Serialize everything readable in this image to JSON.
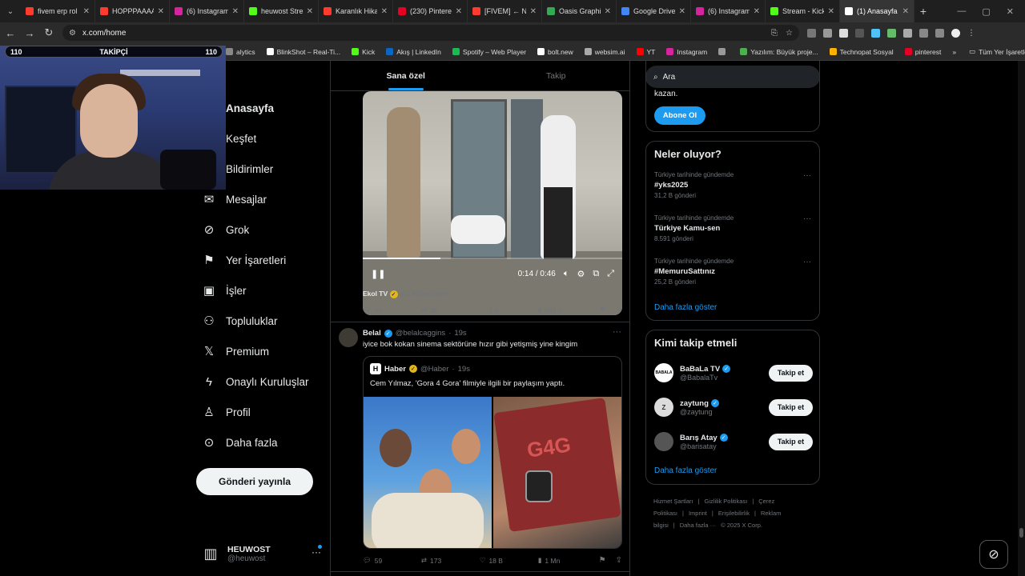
{
  "browser": {
    "tabs": [
      {
        "title": "fivem erp rol",
        "color": "#ff3b30"
      },
      {
        "title": "HOPPPAAAA",
        "color": "#ff3b30"
      },
      {
        "title": "(6) Instagram",
        "color": "#d6249f"
      },
      {
        "title": "heuwost Stream",
        "color": "#53fc18"
      },
      {
        "title": "Karanlık Hikay",
        "color": "#ff3b30"
      },
      {
        "title": "(230) Pinterest",
        "color": "#e60023"
      },
      {
        "title": "[FIVEM] ← NO",
        "color": "#ff3b30"
      },
      {
        "title": "Oasis Graphic",
        "color": "#34a853"
      },
      {
        "title": "Google Drive",
        "color": "#4285f4"
      },
      {
        "title": "(6) Instagram",
        "color": "#d6249f"
      },
      {
        "title": "Stream - Kick",
        "color": "#53fc18"
      },
      {
        "title": "(1) Anasayfa /",
        "color": "#ffffff"
      }
    ],
    "url": "x.com/home",
    "bookmarks": [
      {
        "label": "alytics",
        "color": "#888888"
      },
      {
        "label": "BlinkShot – Real-Ti...",
        "color": "#ffffff"
      },
      {
        "label": "Kick",
        "color": "#53fc18"
      },
      {
        "label": "Akış | LinkedIn",
        "color": "#0a66c2"
      },
      {
        "label": "Spotify – Web Player",
        "color": "#1db954"
      },
      {
        "label": "bolt.new",
        "color": "#ffffff"
      },
      {
        "label": "websim.ai",
        "color": "#aaaaaa"
      },
      {
        "label": "YT",
        "color": "#ff0000"
      },
      {
        "label": "Instagram",
        "color": "#d6249f"
      },
      {
        "label": "",
        "color": "#999999"
      },
      {
        "label": "Yazılım: Büyük proje...",
        "color": "#4caf50"
      },
      {
        "label": "Technopat Sosyal",
        "color": "#ffb300"
      },
      {
        "label": "pinterest",
        "color": "#e60023"
      }
    ],
    "bookmarks_overflow": "»",
    "all_bookmarks": "Tüm Yer İşaretleri"
  },
  "overlay": {
    "follower_left": "110",
    "follower_label": "TAKİPÇİ",
    "follower_right": "110"
  },
  "nav": {
    "items": [
      {
        "label": "Anasayfa",
        "icon": "home-icon"
      },
      {
        "label": "Keşfet",
        "icon": "search-icon"
      },
      {
        "label": "Bildirimler",
        "icon": "bell-icon"
      },
      {
        "label": "Mesajlar",
        "icon": "mail-icon"
      },
      {
        "label": "Grok",
        "icon": "grok-icon"
      },
      {
        "label": "Yer İşaretleri",
        "icon": "bookmark-icon"
      },
      {
        "label": "İşler",
        "icon": "briefcase-icon"
      },
      {
        "label": "Topluluklar",
        "icon": "people-icon"
      },
      {
        "label": "Premium",
        "icon": "x-logo-icon"
      },
      {
        "label": "Onaylı Kuruluşlar",
        "icon": "lightning-icon"
      },
      {
        "label": "Profil",
        "icon": "person-icon"
      },
      {
        "label": "Daha fazla",
        "icon": "more-circle-icon"
      }
    ],
    "post_button": "Gönderi yayınla",
    "account": {
      "name": "HEUWOST",
      "handle": "@heuwost"
    }
  },
  "feed": {
    "tabs": [
      "Sana özel",
      "Takip"
    ],
    "post1": {
      "video_time": "0:14 / 0:46",
      "video_progress": 0.3,
      "source_name": "Ekol TV",
      "source_suffix": "adlı kullanıcıdan",
      "replies": "46",
      "reposts": "38",
      "likes": "1 B",
      "views": "586 B"
    },
    "post2": {
      "name": "Belal",
      "handle": "@belalcaggins",
      "time": "19s",
      "text": "iyice bok kokan sinema sektörüne hızır gibi yetişmiş yine kingim",
      "quote": {
        "avatar_letter": "H",
        "name": "Haber",
        "handle": "@Haber",
        "time": "19s",
        "text": "Cem Yılmaz, 'Gora 4 Gora' filmiyle ilgili bir paylaşım yaptı.",
        "book_text": "G4G"
      },
      "replies": "59",
      "reposts": "173",
      "likes": "18 B",
      "views": "1 Mn"
    }
  },
  "sidebar": {
    "search_placeholder": "Ara",
    "premium_text": "kazan.",
    "premium_button": "Abone Ol",
    "trends_title": "Neler oluyor?",
    "trends": [
      {
        "context": "Türkiye tarihinde gündemde",
        "title": "#yks2025",
        "count": "31,2 B gönderi"
      },
      {
        "context": "Türkiye tarihinde gündemde",
        "title": "Türkiye Kamu-sen",
        "count": "8.591 gönderi"
      },
      {
        "context": "Türkiye tarihinde gündemde",
        "title": "#MemuruSattınız",
        "count": "25,2 B gönderi"
      }
    ],
    "show_more": "Daha fazla göster",
    "follow_title": "Kimi takip etmeli",
    "follow": [
      {
        "name": "BaBaLa TV",
        "handle": "@BabalaTv",
        "avatar_text": "BABALA",
        "avatar_bg": "#ffffff",
        "avatar_fg": "#000000"
      },
      {
        "name": "zaytung",
        "handle": "@zaytung",
        "avatar_text": "Z",
        "avatar_bg": "#dcdcdc",
        "avatar_fg": "#333333"
      },
      {
        "name": "Barış Atay",
        "handle": "@barisatay",
        "avatar_text": "",
        "avatar_bg": "#555555",
        "avatar_fg": "#ffffff"
      }
    ],
    "follow_button": "Takip et",
    "footer": [
      "Hizmet Şartları",
      "|",
      "Gizlilik Politikası",
      "|",
      "Çerez Politikası",
      "|",
      "Imprint",
      "|",
      "Erişilebilirlik",
      "|",
      "Reklam bilgisi",
      "|",
      "Daha fazla ···",
      "© 2025 X Corp."
    ]
  },
  "colors": {
    "accent": "#1d9bf0",
    "background": "#000000",
    "muted": "#71767b"
  }
}
